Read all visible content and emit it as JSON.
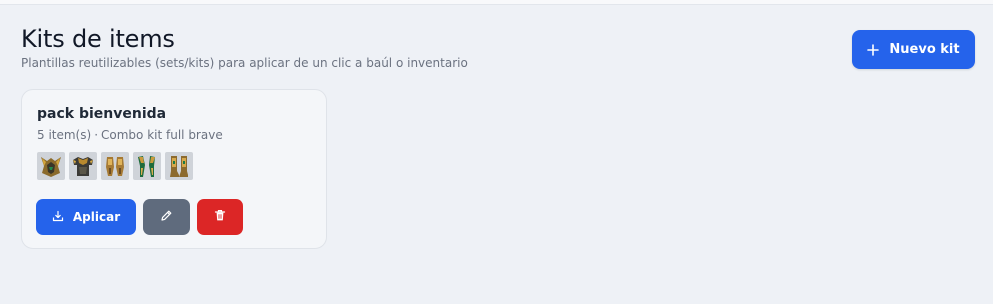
{
  "header": {
    "title": "Kits de items",
    "subtitle": "Plantillas reutilizables (sets/kits) para aplicar de un clic a baúl o inventario",
    "new_kit_label": "Nuevo kit",
    "new_kit_icon": "plus-icon"
  },
  "kits": [
    {
      "name": "pack bienvenida",
      "item_count": "5 item(s)",
      "separator": "·",
      "description": "Combo kit full brave",
      "items": [
        {
          "icon": "armor-helmet-icon"
        },
        {
          "icon": "armor-chest-icon"
        },
        {
          "icon": "armor-gloves-icon"
        },
        {
          "icon": "armor-pants-icon"
        },
        {
          "icon": "armor-boots-icon"
        }
      ],
      "actions": {
        "apply_label": "Aplicar",
        "apply_icon": "download-icon",
        "edit_icon": "pencil-icon",
        "delete_icon": "trash-icon"
      }
    }
  ],
  "colors": {
    "background": "#eef1f6",
    "primary": "#2563eb",
    "secondary": "#5f6b7d",
    "danger": "#dc2626",
    "card": "#f4f6f9"
  }
}
